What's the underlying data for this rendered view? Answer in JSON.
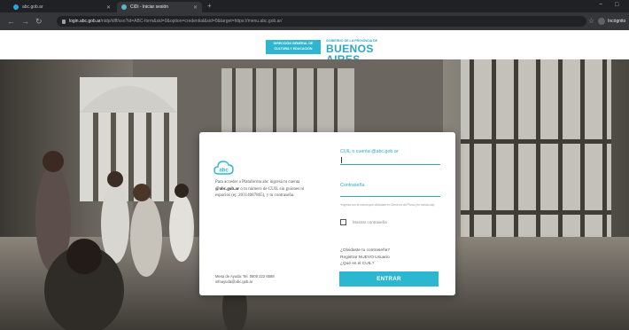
{
  "browser": {
    "tabs": [
      {
        "title": "abc.gob.ar",
        "favicon_color": "#2aa7d8",
        "active": false
      },
      {
        "title": "CiDi - Iniciar sesión",
        "favicon_color": "#5fb3c9",
        "active": true
      }
    ],
    "new_tab_icon": "plus-icon",
    "url_host": "login.abc.gob.ar",
    "url_path": "/nidp/idff/sso?id=ABC-form&sid=0&option=credential&sid=0&target=https://menu.abc.gob.ar/",
    "profile_label": "Incógnito",
    "window_controls": [
      "−",
      "□"
    ]
  },
  "site_header": {
    "dgce_logo": [
      "DIRECCIÓN GENERAL DE",
      "CULTURA Y EDUCACIÓN"
    ],
    "gba_logo_top": "GOBIERNO DE LA PROVINCIA DE",
    "gba_logo_main": "BUENOS AIRES"
  },
  "login": {
    "logo_text": "abc",
    "intro_segments": [
      "Para acceder a Plataforma abc ingresá tu cuenta ",
      "@abc.gob.ar",
      " o tu número de CUIL sin guiones ni espacios (ej: 20314087865), y tu contraseña."
    ],
    "cuil_label": "CUIL o cuenta @abc.gob.ar",
    "cuil_value": "",
    "password_label": "Contraseña",
    "password_value": "",
    "password_hint": "*Ingresá con la misma que utilizabas en Servicios del Portal (en minúscula).",
    "show_password_label": "Mostrar contraseña",
    "links": [
      "¿Olvidaste tu contraseña?",
      "Registrar NUEVO Usuario",
      "¿Qué es el CUIL?"
    ],
    "submit_label": "ENTRAR",
    "help_lines": [
      "Mesa de Ayuda: Tel. 0800 222 6588",
      "infoayuda@abc.gob.ar"
    ]
  },
  "colors": {
    "accent": "#2ab7cf",
    "logo_blue": "#2aa7c5",
    "chrome_dark": "#202124"
  }
}
